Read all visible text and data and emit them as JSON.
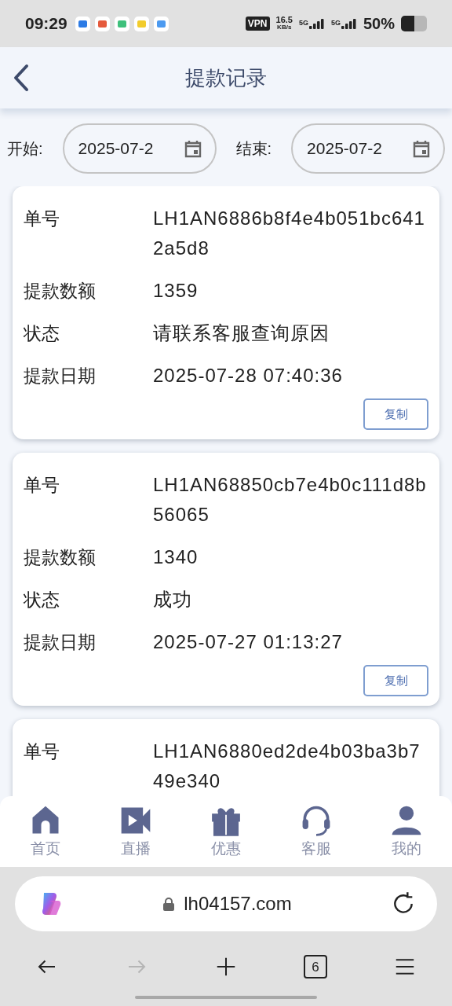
{
  "status_bar": {
    "time": "09:29",
    "vpn": "VPN",
    "speed_value": "16.5",
    "speed_unit": "KB/s",
    "network_1": "5G",
    "network_2": "5G",
    "battery": "50%"
  },
  "header": {
    "title": "提款记录"
  },
  "filter": {
    "start_label": "开始:",
    "start_value": "2025-07-2",
    "end_label": "结束:",
    "end_value": "2025-07-2"
  },
  "records": [
    {
      "rows": [
        {
          "label": "单号",
          "value": "LH1AN6886b8f4e4b051bc6412a5d8"
        },
        {
          "label": "提款数额",
          "value": "1359"
        },
        {
          "label": "状态",
          "value": "请联系客服查询原因"
        },
        {
          "label": "提款日期",
          "value": "2025-07-28 07:40:36"
        }
      ],
      "button": "复制"
    },
    {
      "rows": [
        {
          "label": "单号",
          "value": "LH1AN68850cb7e4b0c111d8b56065"
        },
        {
          "label": "提款数额",
          "value": "1340"
        },
        {
          "label": "状态",
          "value": "成功"
        },
        {
          "label": "提款日期",
          "value": "2025-07-27 01:13:27"
        }
      ],
      "button": "复制"
    },
    {
      "rows": [
        {
          "label": "单号",
          "value": "LH1AN6880ed2de4b03ba3b749e340"
        }
      ]
    }
  ],
  "tab_bar": [
    {
      "kind": "home",
      "label": "首页"
    },
    {
      "kind": "video",
      "label": "直播"
    },
    {
      "kind": "gift",
      "label": "优惠"
    },
    {
      "kind": "support",
      "label": "客服"
    },
    {
      "kind": "user",
      "label": "我的"
    }
  ],
  "browser": {
    "url": "lh04157.com",
    "tab_count": "6",
    "nav": [
      {
        "kind": "back",
        "disabled": false
      },
      {
        "kind": "forward",
        "disabled": true
      },
      {
        "kind": "new",
        "disabled": false
      },
      {
        "kind": "tabs",
        "disabled": false
      },
      {
        "kind": "menu",
        "disabled": false
      }
    ]
  }
}
